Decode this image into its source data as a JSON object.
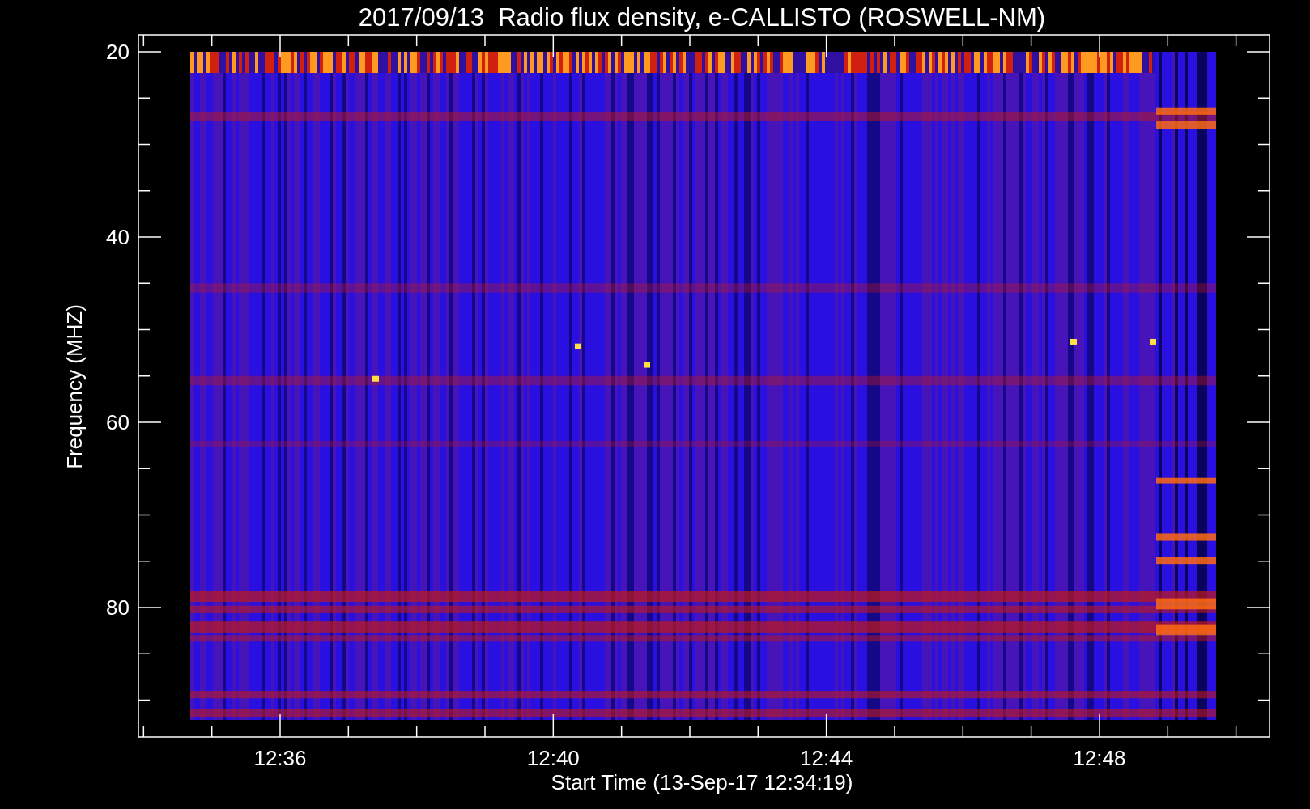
{
  "title": "2017/09/13  Radio flux density, e-CALLISTO (ROSWELL-NM)",
  "ylabel": "Frequency (MHZ)",
  "xlabel": "Start Time (13-Sep-17 12:34:19)",
  "yticks": [
    "20",
    "40",
    "60",
    "80"
  ],
  "xticks": [
    "12:36",
    "12:40",
    "12:44",
    "12:48"
  ]
}
